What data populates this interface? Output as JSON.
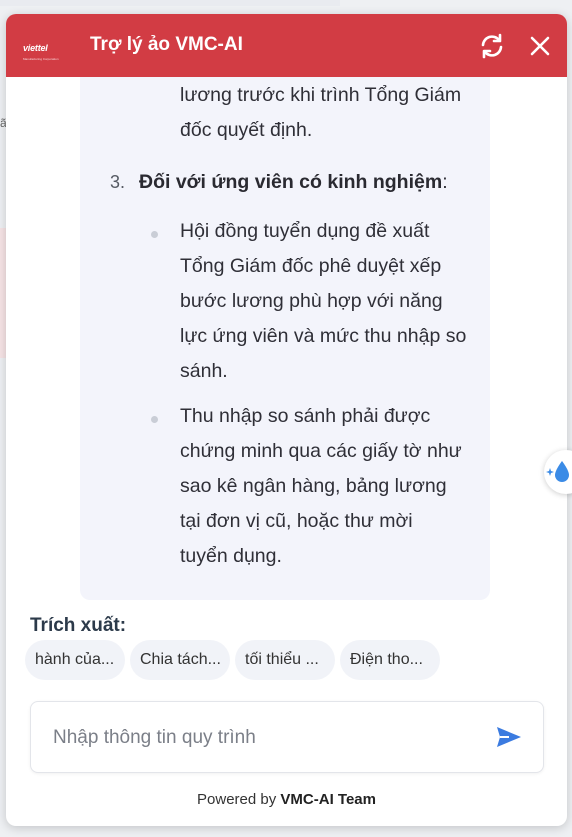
{
  "header": {
    "logo_text": "viettel",
    "logo_subtext": "Manufacturing Corporation",
    "title": "Trợ lý ảo VMC-AI",
    "refresh_icon": "refresh-icon",
    "close_icon": "close-icon"
  },
  "message": {
    "prev_lines": [
      "lương trước khi trình Tổng Giám",
      "đốc quyết định."
    ],
    "item3_number": "3.",
    "item3_bold": "Đối với ứng viên có kinh nghiệm",
    "item3_colon": ":",
    "bullet1_lines": [
      "Hội đồng tuyển dụng đề xuất",
      "Tổng Giám đốc phê duyệt xếp",
      "bước lương phù hợp với năng",
      "lực ứng viên và mức thu nhập so",
      "sánh."
    ],
    "bullet2_lines": [
      "Thu nhập so sánh phải được",
      "chứng minh qua các giấy tờ như",
      "sao kê ngân hàng, bảng lương",
      "tại đơn vị cũ, hoặc thư mời",
      "tuyển dụng."
    ]
  },
  "extract": {
    "label": "Trích xuất:",
    "chips": [
      "hành của...",
      "Chia tách...",
      "tối thiểu ...",
      "Điện tho..."
    ]
  },
  "input": {
    "placeholder": "Nhập thông tin quy trình",
    "value": "",
    "send_icon": "send-icon"
  },
  "footer": {
    "powered_prefix": "Powered by",
    "powered_team": "VMC-AI Team"
  },
  "floating_button_icon": "sparkle-drop-icon",
  "colors": {
    "header_bg": "#d23c44",
    "bubble_bg": "#f3f4fb",
    "send_accent": "#3b7be0"
  }
}
